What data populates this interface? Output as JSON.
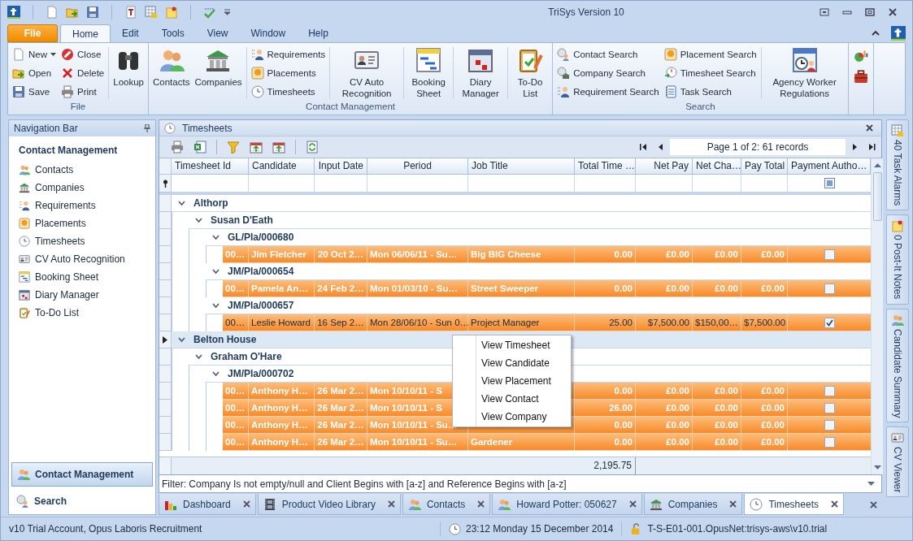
{
  "window": {
    "title": "TriSys Version 10"
  },
  "ribbon_tabs": [
    {
      "label": "File",
      "kind": "application",
      "selected": false
    },
    {
      "label": "Home",
      "kind": "tab",
      "selected": true
    },
    {
      "label": "Edit",
      "kind": "tab",
      "selected": false
    },
    {
      "label": "Tools",
      "kind": "tab",
      "selected": false
    },
    {
      "label": "View",
      "kind": "tab",
      "selected": false
    },
    {
      "label": "Window",
      "kind": "tab",
      "selected": false
    },
    {
      "label": "Help",
      "kind": "tab",
      "selected": false
    }
  ],
  "ribbon_groups": [
    {
      "label": "File",
      "columns": [
        {
          "kind": "stack",
          "items": [
            {
              "label": "New",
              "dropdown": true
            },
            {
              "label": "Open",
              "dropdown": false
            },
            {
              "label": "Save",
              "dropdown": false
            }
          ]
        },
        {
          "kind": "stack",
          "items": [
            {
              "label": "Close",
              "dropdown": false
            },
            {
              "label": "Delete",
              "dropdown": false
            },
            {
              "label": "Print",
              "dropdown": false
            }
          ]
        },
        {
          "kind": "large",
          "label": "Lookup"
        }
      ]
    },
    {
      "label": "Contact Management",
      "columns": [
        {
          "kind": "large",
          "label": "Contacts"
        },
        {
          "kind": "large",
          "label": "Companies"
        },
        {
          "kind": "stack",
          "items": [
            {
              "label": "Requirements",
              "dropdown": false
            },
            {
              "label": "Placements",
              "dropdown": false
            },
            {
              "label": "Timesheets",
              "dropdown": false
            }
          ]
        },
        {
          "kind": "large",
          "label": "CV Auto Recognition"
        },
        {
          "kind": "large",
          "label": "Booking Sheet"
        },
        {
          "kind": "large",
          "label": "Diary Manager"
        },
        {
          "kind": "large",
          "label": "To-Do List"
        }
      ]
    },
    {
      "label": "Search",
      "columns": [
        {
          "kind": "stack",
          "items": [
            {
              "label": "Contact Search",
              "dropdown": false
            },
            {
              "label": "Company Search",
              "dropdown": false
            },
            {
              "label": "Requirement Search",
              "dropdown": false
            }
          ]
        },
        {
          "kind": "stack",
          "items": [
            {
              "label": "Placement Search",
              "dropdown": false
            },
            {
              "label": "Timesheet Search",
              "dropdown": false
            },
            {
              "label": "Task Search",
              "dropdown": false
            }
          ]
        },
        {
          "kind": "large",
          "label": "Agency Worker Regulations"
        }
      ]
    }
  ],
  "navigation": {
    "title": "Navigation Bar",
    "section": "Contact Management",
    "items": [
      {
        "label": "Contacts",
        "selected": false
      },
      {
        "label": "Companies",
        "selected": false
      },
      {
        "label": "Requirements",
        "selected": false
      },
      {
        "label": "Placements",
        "selected": false
      },
      {
        "label": "Timesheets",
        "selected": false
      },
      {
        "label": "CV Auto Recognition",
        "selected": false
      },
      {
        "label": "Booking Sheet",
        "selected": false
      },
      {
        "label": "Diary Manager",
        "selected": false
      },
      {
        "label": "To-Do List",
        "selected": false
      }
    ],
    "buttons": [
      {
        "label": "Contact Management",
        "selected": true
      },
      {
        "label": "Search",
        "selected": false
      }
    ]
  },
  "document": {
    "title": "Timesheets",
    "pager": "Page 1 of 2: 61 records",
    "columns": [
      "Timesheet Id",
      "Candidate",
      "Input Date",
      "Period",
      "Job Title",
      "Total Time …",
      "Net Pay",
      "Net Cha…",
      "Pay Total",
      "Payment Autho…"
    ],
    "filter_row": {
      "payment_authorised_indeterminate": true
    },
    "groups": [
      {
        "label": "Althorp",
        "selected": false,
        "expanded": true,
        "children": [
          {
            "label": "Susan D'Eath",
            "selected": false,
            "expanded": true,
            "children": [
              {
                "label": "GL/Pla/000680",
                "selected": false,
                "expanded": true,
                "rows": [
                  {
                    "id": "00…",
                    "candidate": "Jim Fletcher",
                    "input_date": "20 Oct 2…",
                    "period": "Mon 06/06/11 - Su…",
                    "job_title": "Big BIG Cheese",
                    "total_time": "0.00",
                    "net_pay": "£0.00",
                    "net_charge": "£0.00",
                    "pay_total": "£0.00",
                    "authorised": false,
                    "selected": false
                  }
                ]
              },
              {
                "label": "JM/Pla/000654",
                "selected": false,
                "expanded": true,
                "rows": [
                  {
                    "id": "00…",
                    "candidate": "Pamela An…",
                    "input_date": "24 Feb 2…",
                    "period": "Mon 01/03/10 - Su…",
                    "job_title": "Street Sweeper",
                    "total_time": "0.00",
                    "net_pay": "£0.00",
                    "net_charge": "£0.00",
                    "pay_total": "£0.00",
                    "authorised": false,
                    "selected": false
                  }
                ]
              },
              {
                "label": "JM/Pla/000657",
                "selected": false,
                "expanded": true,
                "rows": [
                  {
                    "id": "00…",
                    "candidate": "Leslie Howard",
                    "input_date": "16 Sep 2…",
                    "period": "Mon 28/06/10 - Sun 0…",
                    "job_title": "Project Manager",
                    "total_time": "25.00",
                    "net_pay": "$7,500.00",
                    "net_charge": "$150,00…",
                    "pay_total": "$7,500.00",
                    "authorised": true,
                    "selected": true
                  }
                ]
              }
            ]
          }
        ]
      },
      {
        "label": "Belton House",
        "selected": true,
        "expanded": true,
        "children": [
          {
            "label": "Graham O'Hare",
            "selected": false,
            "expanded": true,
            "children": [
              {
                "label": "JM/Pla/000702",
                "selected": false,
                "expanded": true,
                "rows": [
                  {
                    "id": "00…",
                    "candidate": "Anthony H…",
                    "input_date": "26 Mar 2…",
                    "period": "Mon 10/10/11 - S",
                    "total_time": "0.00",
                    "net_pay": "£0.00",
                    "net_charge": "£0.00",
                    "pay_total": "£0.00",
                    "authorised": false,
                    "selected": false
                  },
                  {
                    "id": "00…",
                    "candidate": "Anthony H…",
                    "input_date": "26 Mar 2…",
                    "period": "Mon 10/10/11 - S",
                    "total_time": "26.00",
                    "net_pay": "£0.00",
                    "net_charge": "£0.00",
                    "pay_total": "£0.00",
                    "authorised": false,
                    "selected": false
                  },
                  {
                    "id": "00…",
                    "candidate": "Anthony H…",
                    "input_date": "26 Mar 2…",
                    "period": "Mon 10/10/11 - Su…",
                    "total_time": "0.00",
                    "net_pay": "£0.00",
                    "net_charge": "£0.00",
                    "pay_total": "£0.00",
                    "authorised": false,
                    "selected": false
                  },
                  {
                    "id": "00…",
                    "candidate": "Anthony H…",
                    "input_date": "26 Mar 2…",
                    "period": "Mon 10/10/11 - Su…",
                    "job_title": "Gardener",
                    "total_time": "0.00",
                    "net_pay": "£0.00",
                    "net_charge": "£0.00",
                    "pay_total": "£0.00",
                    "authorised": false,
                    "selected": false
                  }
                ]
              }
            ]
          }
        ]
      }
    ],
    "total_time_sum": "2,195.75",
    "filter": "Filter: Company Is not empty/null and Client Begins with [a-z] and Reference Begins with [a-z]",
    "context_menu": [
      "View Timesheet",
      "View Candidate",
      "View Placement",
      "View Contact",
      "View Company"
    ]
  },
  "tabs": [
    {
      "label": "Dashboard",
      "selected": false
    },
    {
      "label": "Product Video Library",
      "selected": false
    },
    {
      "label": "Contacts",
      "selected": false
    },
    {
      "label": "Howard Potter: 050627",
      "selected": false
    },
    {
      "label": "Companies",
      "selected": false
    },
    {
      "label": "Timesheets",
      "selected": true
    }
  ],
  "dock": [
    {
      "label": "40 Task Alarms"
    },
    {
      "label": "0 Post-It Notes"
    },
    {
      "label": "Candidate Summary"
    },
    {
      "label": "CV Viewer"
    }
  ],
  "status_bar": [
    "v10 Trial Account, Opus Laboris Recruitment",
    "23:12 Monday 15 December 2014",
    "T-S-E01-001.OpusNet:trisys-aws\\v10.trial"
  ]
}
